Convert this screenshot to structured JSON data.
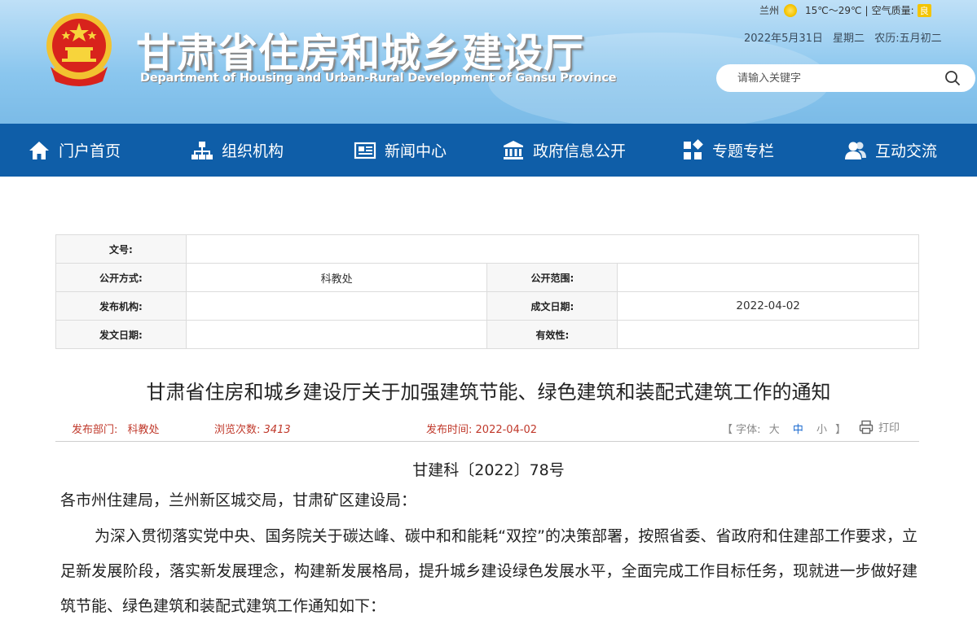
{
  "header": {
    "site_title": "甘肃省住房和城乡建设厅",
    "site_subtitle": "Department of Housing and Urban-Rural Development of Gansu Province",
    "weather": {
      "city": "兰州",
      "temperature": "15℃～29℃",
      "separator": "|",
      "air_quality_label": "空气质量:",
      "air_quality_value": "良"
    },
    "date": {
      "gregorian": "2022年5月31日",
      "weekday": "星期二",
      "lunar": "农历:五月初二"
    },
    "search": {
      "placeholder": "请输入关键字",
      "icon": "search-icon"
    }
  },
  "nav": {
    "items": [
      {
        "label": "门户首页",
        "icon": "home-icon"
      },
      {
        "label": "组织机构",
        "icon": "org-chart-icon"
      },
      {
        "label": "新闻中心",
        "icon": "newspaper-icon"
      },
      {
        "label": "政府信息公开",
        "icon": "government-building-icon"
      },
      {
        "label": "专题专栏",
        "icon": "grid-blocks-icon"
      },
      {
        "label": "互动交流",
        "icon": "users-icon"
      }
    ]
  },
  "info_table": {
    "doc_no_label": "文号:",
    "doc_no_value": "",
    "disclosure_method_label": "公开方式:",
    "disclosure_method_value": "科教处",
    "disclosure_scope_label": "公开范围:",
    "disclosure_scope_value": "",
    "issuer_label": "发布机构:",
    "issuer_value": "",
    "creation_date_label": "成文日期:",
    "creation_date_value": "2022-04-02",
    "issue_date_label": "发文日期:",
    "issue_date_value": "",
    "validity_label": "有效性:",
    "validity_value": ""
  },
  "article": {
    "title": "甘肃省住房和城乡建设厅关于加强建筑节能、绿色建筑和装配式建筑工作的通知",
    "meta": {
      "department_label": "发布部门:",
      "department_value": "科教处",
      "views_label": "浏览次数:",
      "views_value": "3413",
      "publish_time_label": "发布时间:",
      "publish_time_value": "2022-04-02"
    },
    "font_size": {
      "open_bracket": "【",
      "label": "字体:",
      "large": "大",
      "medium": "中",
      "small": "小",
      "close_bracket": "】",
      "active": "medium"
    },
    "print_label": "打印",
    "doc_number": "甘建科〔2022〕78号",
    "addressee": "各市州住建局，兰州新区城交局，甘肃矿区建设局：",
    "paragraph1": "为深入贯彻落实党中央、国务院关于碳达峰、碳中和和能耗“双控”的决策部署，按照省委、省政府和住建部工作要求，立足新发展阶段，落实新发展理念，构建新发展格局，提升城乡建设绿色发展水平，全面完成工作目标任务，现就进一步做好建筑节能、绿色建筑和装配式建筑工作通知如下："
  },
  "colors": {
    "nav_background": "#0f5ea8",
    "meta_red": "#c0392b",
    "active_font_blue": "#1a6ad0",
    "aqi_badge": "#f4c400"
  }
}
